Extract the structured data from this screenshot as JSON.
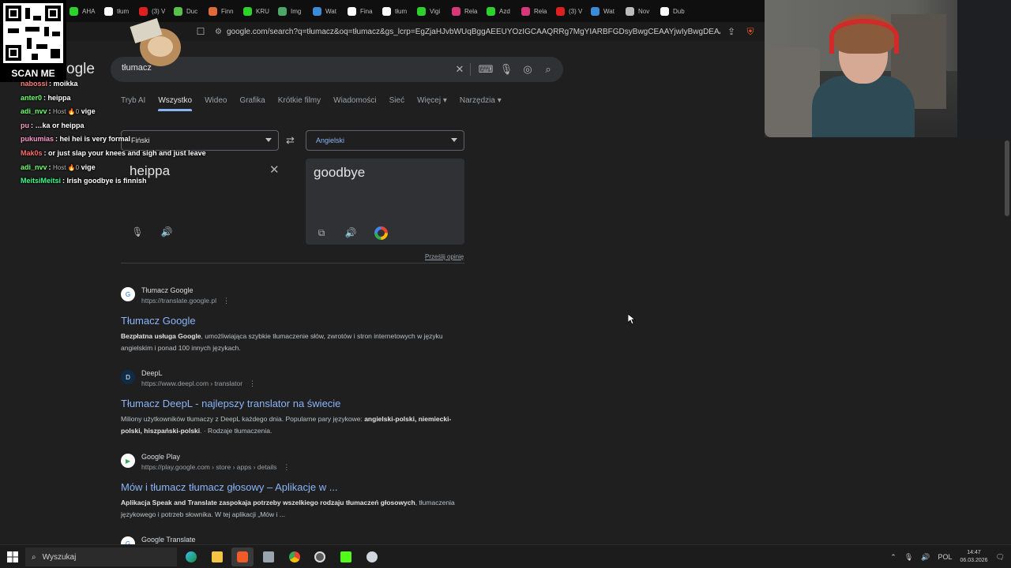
{
  "tabs": [
    {
      "label": "AHA",
      "color": "#2cd12c"
    },
    {
      "label": "tłum",
      "color": "#ffffff"
    },
    {
      "label": "(3) V",
      "color": "#e02020"
    },
    {
      "label": "Duc",
      "color": "#57c24a"
    },
    {
      "label": "Finn",
      "color": "#e06a3a"
    },
    {
      "label": "KRU",
      "color": "#2cd12c"
    },
    {
      "label": "Img",
      "color": "#4fa66b"
    },
    {
      "label": "Wat",
      "color": "#3d8bd6"
    },
    {
      "label": "Fina",
      "color": "#ffffff"
    },
    {
      "label": "tłum",
      "color": "#ffffff"
    },
    {
      "label": "Vigi",
      "color": "#2cd12c"
    },
    {
      "label": "Rela",
      "color": "#d6387a"
    },
    {
      "label": "Azd",
      "color": "#2cd12c"
    },
    {
      "label": "Rela",
      "color": "#d6387a"
    },
    {
      "label": "(3) V",
      "color": "#e02020"
    },
    {
      "label": "Wat",
      "color": "#3d8bd6"
    },
    {
      "label": "Nov",
      "color": "#bbbbbb"
    },
    {
      "label": "Dub",
      "color": "#ffffff"
    }
  ],
  "address": {
    "url": "google.com/search?q=tłumacz&oq=tłumacz&gs_lcrp=EgZjaHJvbWUqBggAEEUYOzIGCAAQRRg7MgYIARBFGDsyBwgCEAAYjwIyBwgDEAAYjwIyBggEE..."
  },
  "google": {
    "logo_text": "ogle",
    "search_value": "tłumacz",
    "nav_tabs": [
      "Tryb AI",
      "Wszystko",
      "Wideo",
      "Grafika",
      "Krótkie filmy",
      "Wiadomości",
      "Sieć",
      "Więcej",
      "Narzędzia"
    ]
  },
  "translator": {
    "source_lang": "Fiński",
    "target_lang": "Angielski",
    "source_text": "heippa",
    "target_text": "goodbye",
    "feedback": "Prześlij opinię"
  },
  "results": [
    {
      "site": "Tłumacz Google",
      "url": "https://translate.google.pl",
      "title": "Tłumacz Google",
      "snippet_bold": "Bezpłatna usługa Google",
      "snippet": ", umożliwiająca szybkie tłumaczenie słów, zwrotów i stron internetowych w języku angielskim i ponad 100 innych językach."
    },
    {
      "site": "DeepL",
      "url": "https://www.deepl.com › translator",
      "title": "Tłumacz DeepL - najlepszy translator na świecie",
      "snippet_plain": "Miliony użytkowników tłumaczy z DeepL każdego dnia. Popularne pary językowe: ",
      "snippet_bold": "angielski-polski, niemiecki-polski, hiszpański-polski",
      "snippet_tail": ". · Rodzaje tłumaczenia."
    },
    {
      "site": "Google Play",
      "url": "https://play.google.com › store › apps › details",
      "title": "Mów i tłumacz tłumacz głosowy – Aplikacje w ...",
      "snippet_bold": "Aplikacja Speak and Translate zaspokaja potrzeby wszelkiego rodzaju tłumaczeń głosowych",
      "snippet": ", tłumaczenia językowego i potrzeb słownika. W tej aplikacji „Mów i ..."
    },
    {
      "site": "Google Translate",
      "url": ""
    }
  ],
  "chat": {
    "messages": [
      {
        "user": "nabossi",
        "color": "#ff7a7a",
        "text": "moikka",
        "badge": ""
      },
      {
        "user": "anter0",
        "color": "#6cff6c",
        "text": "heippa",
        "badge": ""
      },
      {
        "user": "adi_nvv",
        "color": "#6cff6c",
        "text": "vige",
        "badge": "Host 🔥0"
      },
      {
        "user": "pu",
        "color": "#ff9acb",
        "text": "…ka or heippa",
        "badge": ""
      },
      {
        "user": "pukumias",
        "color": "#ff9acb",
        "text": "hei hei is very formal",
        "badge": ""
      },
      {
        "user": "Mak0s",
        "color": "#ff6b6b",
        "text": "or just slap your knees and sigh and just leave",
        "badge": ""
      },
      {
        "user": "adi_nvv",
        "color": "#6cff6c",
        "text": "vige",
        "badge": "Host 🔥0"
      },
      {
        "user": "MeitsiMeitsi",
        "color": "#3cff8a",
        "text": "Irish goodbye is finnish",
        "badge": ""
      }
    ]
  },
  "qr": {
    "caption": "SCAN ME"
  },
  "taskbar": {
    "search_placeholder": "Wyszukaj",
    "lang": "POL",
    "time": "14:47",
    "date": "06.03.2026"
  }
}
